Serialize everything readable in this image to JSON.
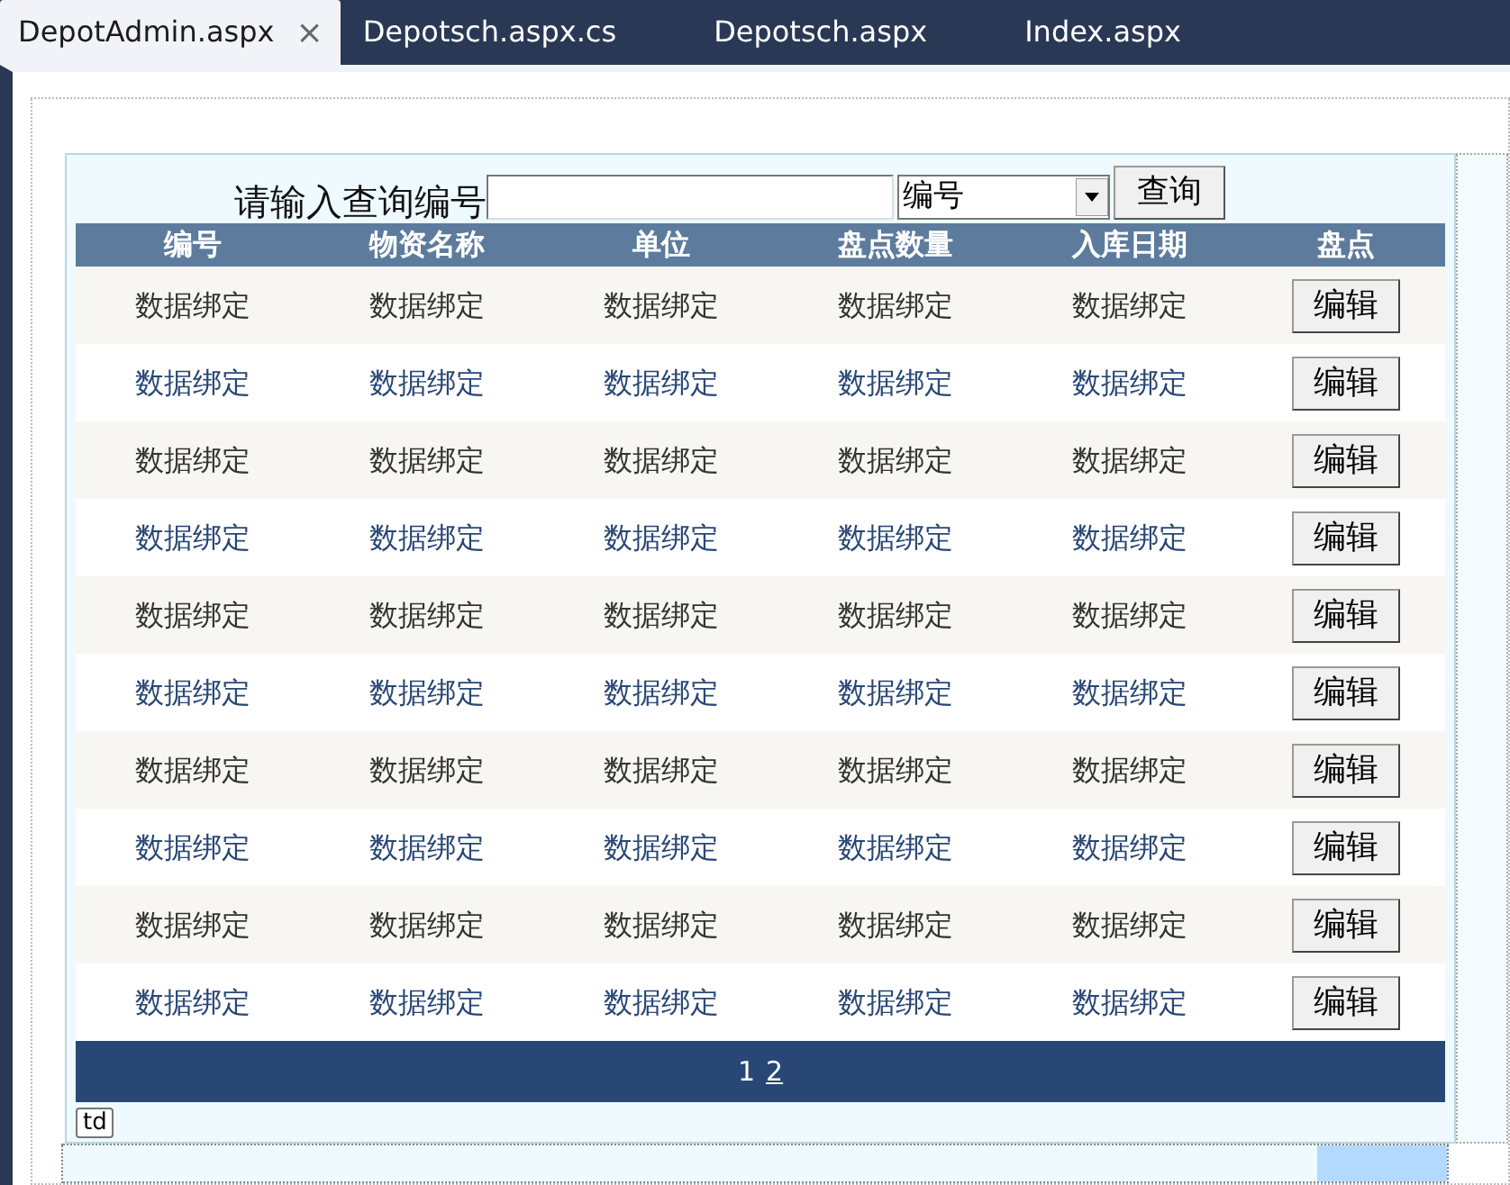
{
  "tabs": [
    {
      "label": "DepotAdmin.aspx",
      "selected": true,
      "close": "×"
    },
    {
      "label": "Depotsch.aspx.cs",
      "selected": false
    },
    {
      "label": "Depotsch.aspx",
      "selected": false
    },
    {
      "label": "Index.aspx",
      "selected": false
    }
  ],
  "search": {
    "label": "请输入查询编号",
    "select_value": "编号",
    "button": "查询"
  },
  "table": {
    "columns": [
      "编号",
      "物资名称",
      "单位",
      "盘点数量",
      "入库日期",
      "盘点"
    ],
    "rows": [
      {
        "cells": [
          "数据绑定",
          "数据绑定",
          "数据绑定",
          "数据绑定",
          "数据绑定"
        ],
        "button": "编辑"
      },
      {
        "cells": [
          "数据绑定",
          "数据绑定",
          "数据绑定",
          "数据绑定",
          "数据绑定"
        ],
        "button": "编辑"
      },
      {
        "cells": [
          "数据绑定",
          "数据绑定",
          "数据绑定",
          "数据绑定",
          "数据绑定"
        ],
        "button": "编辑"
      },
      {
        "cells": [
          "数据绑定",
          "数据绑定",
          "数据绑定",
          "数据绑定",
          "数据绑定"
        ],
        "button": "编辑"
      },
      {
        "cells": [
          "数据绑定",
          "数据绑定",
          "数据绑定",
          "数据绑定",
          "数据绑定"
        ],
        "button": "编辑"
      },
      {
        "cells": [
          "数据绑定",
          "数据绑定",
          "数据绑定",
          "数据绑定",
          "数据绑定"
        ],
        "button": "编辑"
      },
      {
        "cells": [
          "数据绑定",
          "数据绑定",
          "数据绑定",
          "数据绑定",
          "数据绑定"
        ],
        "button": "编辑"
      },
      {
        "cells": [
          "数据绑定",
          "数据绑定",
          "数据绑定",
          "数据绑定",
          "数据绑定"
        ],
        "button": "编辑"
      },
      {
        "cells": [
          "数据绑定",
          "数据绑定",
          "数据绑定",
          "数据绑定",
          "数据绑定"
        ],
        "button": "编辑"
      },
      {
        "cells": [
          "数据绑定",
          "数据绑定",
          "数据绑定",
          "数据绑定",
          "数据绑定"
        ],
        "button": "编辑"
      }
    ],
    "pages": [
      {
        "label": "1",
        "selected": true
      },
      {
        "label": "2",
        "selected": false
      }
    ]
  },
  "tag": "td"
}
